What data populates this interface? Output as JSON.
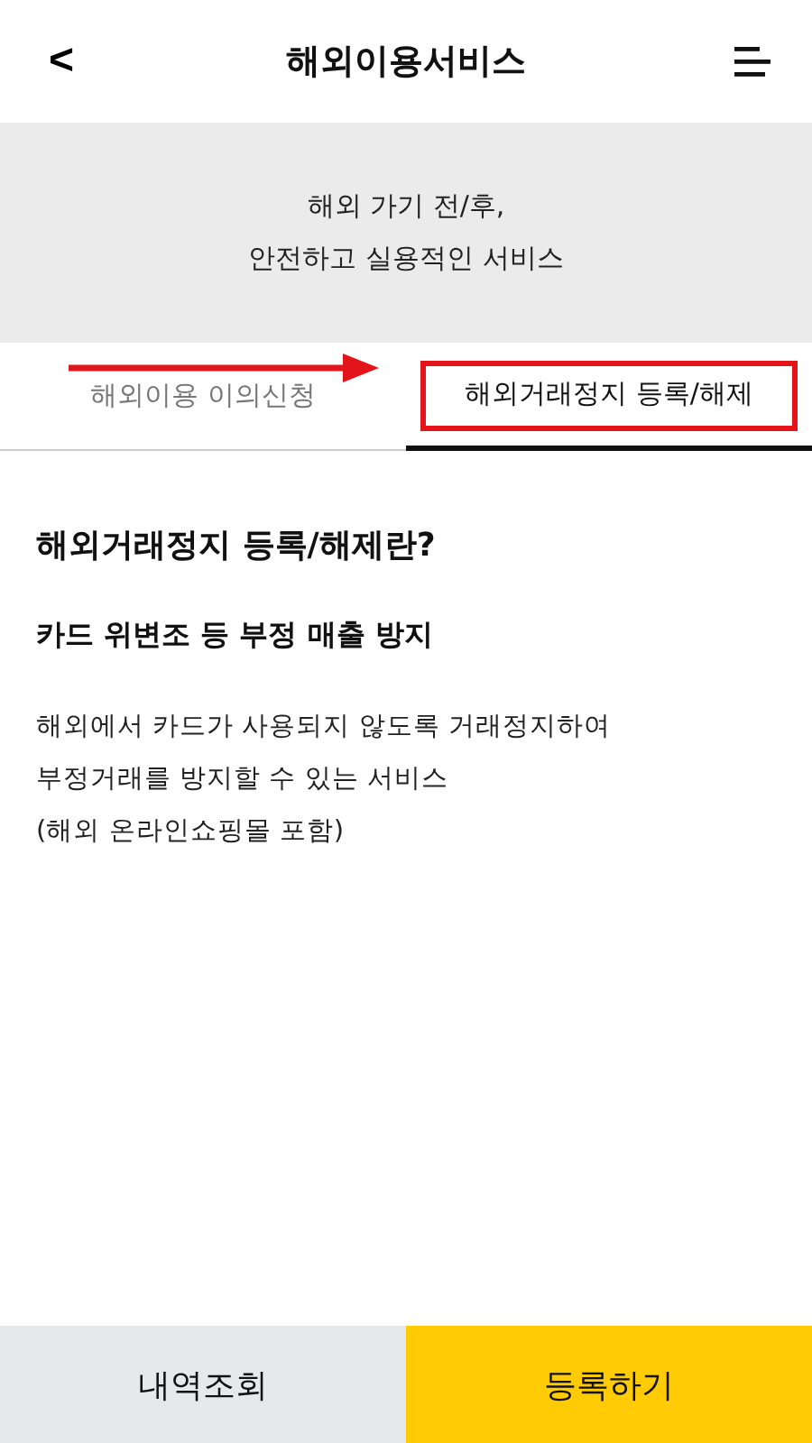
{
  "header": {
    "back": "<",
    "title": "해외이용서비스"
  },
  "banner": {
    "lines": [
      "해외 가기 전/후,",
      "안전하고 실용적인 서비스"
    ]
  },
  "tabs": [
    {
      "label": "해외이용 이의신청",
      "selected": false,
      "highlighted": false
    },
    {
      "label": "해외거래정지 등록/해제",
      "selected": true,
      "highlighted": true
    }
  ],
  "content": {
    "heading": "해외거래정지 등록/해제란?",
    "subheading": "카드 위변조 등 부정 매출 방지",
    "body": [
      "해외에서 카드가 사용되지 않도록 거래정지하여",
      "부정거래를 방지할 수 있는 서비스",
      "(해외 온라인쇼핑몰 포함)"
    ]
  },
  "buttons": [
    {
      "label": "내역조회",
      "kind": "secondary"
    },
    {
      "label": "등록하기",
      "kind": "primary"
    }
  ]
}
